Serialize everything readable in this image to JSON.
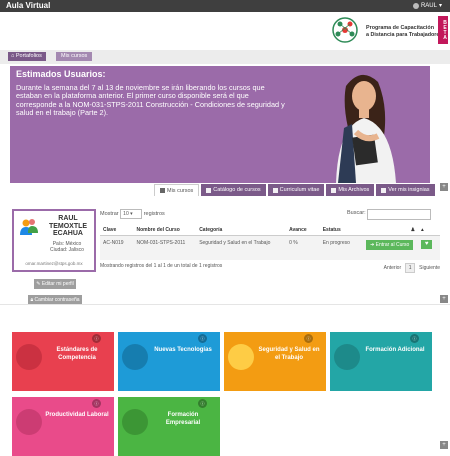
{
  "topbar": {
    "app_title": "Aula Virtual",
    "user_label": "RAUL"
  },
  "header": {
    "logo_line1": "Programa de Capacitación",
    "logo_line2": "a Distancia para Trabajadores",
    "beta_label": "BETA"
  },
  "breadcrumb": {
    "item1": "Portafolios",
    "item2": "Mis cursos"
  },
  "banner": {
    "title": "Estimados Usuarios:",
    "message": "Durante la semana del 7 al 13 de noviembre se irán liberando los cursos que estaban en la plataforma anterior. El primer curso disponible será el que corresponde a la NOM-031-STPS-2011 Construcción - Condiciones de seguridad y salud en el trabajo (Parte 2).",
    "color": "#9b6ba9"
  },
  "tabs": [
    {
      "label": "Mis cursos",
      "icon": "book-icon",
      "active": true
    },
    {
      "label": "Catálogo de cursos",
      "icon": "list-icon",
      "active": false
    },
    {
      "label": "Curriculum vitae",
      "icon": "star-icon",
      "active": false
    },
    {
      "label": "Mis Archivos",
      "icon": "file-icon",
      "active": false
    },
    {
      "label": "Ver mis insignias",
      "icon": "trophy-icon",
      "active": false
    }
  ],
  "profile": {
    "name_line1": "RAUL",
    "name_line2": "TEMOXTLE",
    "name_line3": "ECAHUA",
    "country": "País: México",
    "city": "Ciudad: Jalisco",
    "email": "omar.martinez@stps.gob.mx"
  },
  "profile_actions": {
    "edit_label": "Editar mi perfil",
    "password_label": "Cambiar contraseña"
  },
  "table": {
    "show_label": "Mostrar",
    "page_size": "10",
    "records_label": "registros",
    "search_label": "Buscar:",
    "columns": [
      "Clave",
      "Nombre del Curso",
      "Categoría",
      "Avance",
      "Estatus",
      "",
      ""
    ],
    "rows": [
      {
        "clave": "AC-N019",
        "nombre": "NOM-031-STPS-2011",
        "categoria": "Seguridad y Salud en el Trabajo",
        "avance": "0 %",
        "estatus": "En progreso",
        "enter_label": "Entrar al Curso"
      }
    ],
    "summary": "Mostrando registros del 1 al 1 de un total de 1 registros",
    "prev_label": "Anterior",
    "page_number": "1",
    "next_label": "Siguiente"
  },
  "tiles": [
    {
      "label": "Estándares de Competencia",
      "color": "#e8404f"
    },
    {
      "label": "Nuevas Tecnologías",
      "color": "#1e9bd7"
    },
    {
      "label": "Seguridad y Salud en el Trabajo",
      "color": "#f39c12"
    },
    {
      "label": "Formación Adicional",
      "color": "#23a6a6"
    },
    {
      "label": "Productividad Laboral",
      "color": "#e94b8a"
    },
    {
      "label": "Formación Empresarial",
      "color": "#4bb543"
    }
  ]
}
